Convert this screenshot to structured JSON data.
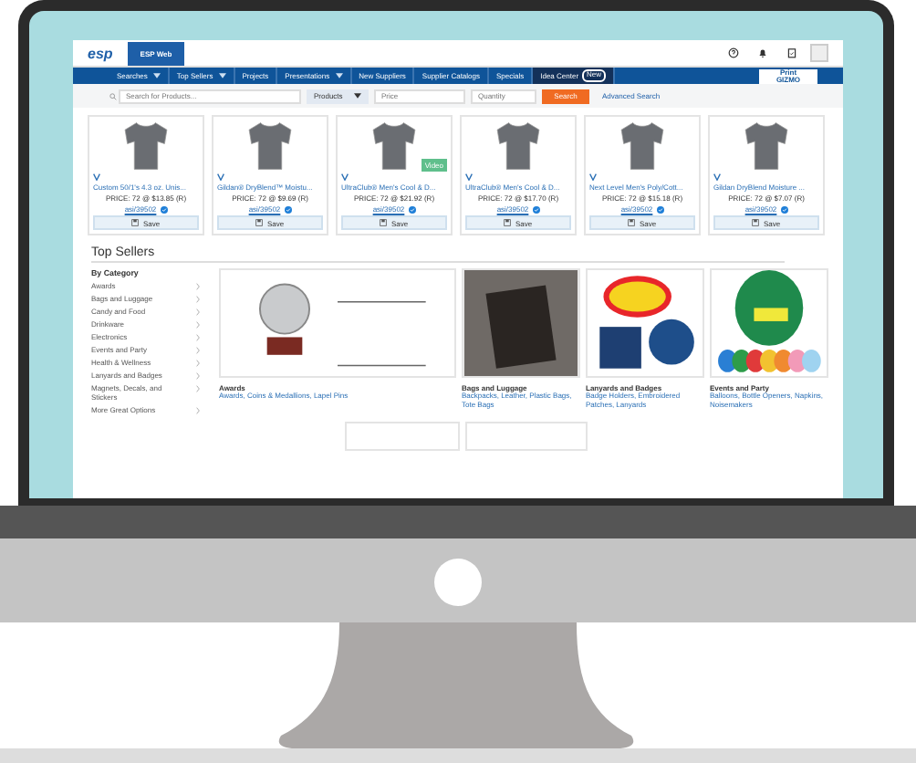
{
  "header": {
    "logo": "esp",
    "tabs": [
      {
        "label": "ESP Web",
        "selected": true
      }
    ]
  },
  "nav": {
    "items": [
      {
        "label": "Searches",
        "dropdown": true,
        "selected": false
      },
      {
        "label": "Top Sellers",
        "dropdown": true,
        "selected": false
      },
      {
        "label": "Projects",
        "dropdown": false,
        "selected": false
      },
      {
        "label": "Presentations",
        "dropdown": true,
        "selected": false
      },
      {
        "label": "New Suppliers",
        "dropdown": false,
        "selected": false
      },
      {
        "label": "Supplier Catalogs",
        "dropdown": false,
        "selected": false
      },
      {
        "label": "Specials",
        "dropdown": false,
        "selected": false
      },
      {
        "label": "Idea Center",
        "dropdown": false,
        "selected": true,
        "badge": "New"
      }
    ],
    "brand": {
      "top": "Print",
      "bottom": "GIZMO"
    }
  },
  "search": {
    "placeholder": "Search for Products...",
    "scope": "Products",
    "price_placeholder": "Price",
    "quantity_placeholder": "Quantity",
    "button": "Search",
    "link": "Advanced Search"
  },
  "products": [
    {
      "title": "Custom 50/1's 4.3 oz. Unis...",
      "price": "PRICE: 72 @ $13.85 (R)",
      "supplier": "asi/39502",
      "save": "Save"
    },
    {
      "title": "Gildan® DryBlend™ Moistu...",
      "price": "PRICE: 72 @ $9.69 (R)",
      "supplier": "asi/39502",
      "save": "Save"
    },
    {
      "title": "UltraClub® Men's Cool & D...",
      "price": "PRICE: 72 @ $21.92 (R)",
      "supplier": "asi/39502",
      "save": "Save",
      "badge": "Video"
    },
    {
      "title": "UltraClub® Men's Cool & D...",
      "price": "PRICE: 72 @ $17.70 (R)",
      "supplier": "asi/39502",
      "save": "Save"
    },
    {
      "title": "Next Level Men's Poly/Cott...",
      "price": "PRICE: 72 @ $15.18 (R)",
      "supplier": "asi/39502",
      "save": "Save"
    },
    {
      "title": "Gildan DryBlend Moisture ...",
      "price": "PRICE: 72 @ $7.07 (R)",
      "supplier": "asi/39502",
      "save": "Save"
    }
  ],
  "top_sellers": {
    "heading": "Top Sellers",
    "sidebar_title": "By Category",
    "categories": [
      "Awards",
      "Bags and Luggage",
      "Candy and Food",
      "Drinkware",
      "Electronics",
      "Events and Party",
      "Health & Wellness",
      "Lanyards and Badges",
      "Magnets, Decals, and Stickers",
      "More Great Options"
    ],
    "cards": [
      {
        "kind": "wide",
        "title": "Awards",
        "links": "Awards, Coins & Medallions, Lapel Pins"
      },
      {
        "kind": "bags",
        "title": "Bags and Luggage",
        "links": "Backpacks, Leather, Plastic Bags, Tote Bags"
      },
      {
        "kind": "badges",
        "title": "Lanyards and Badges",
        "links": "Badge Holders, Embroidered Patches, Lanyards"
      },
      {
        "kind": "balloons",
        "title": "Events and Party",
        "links": "Balloons, Bottle Openers, Napkins, Noisemakers"
      }
    ]
  }
}
